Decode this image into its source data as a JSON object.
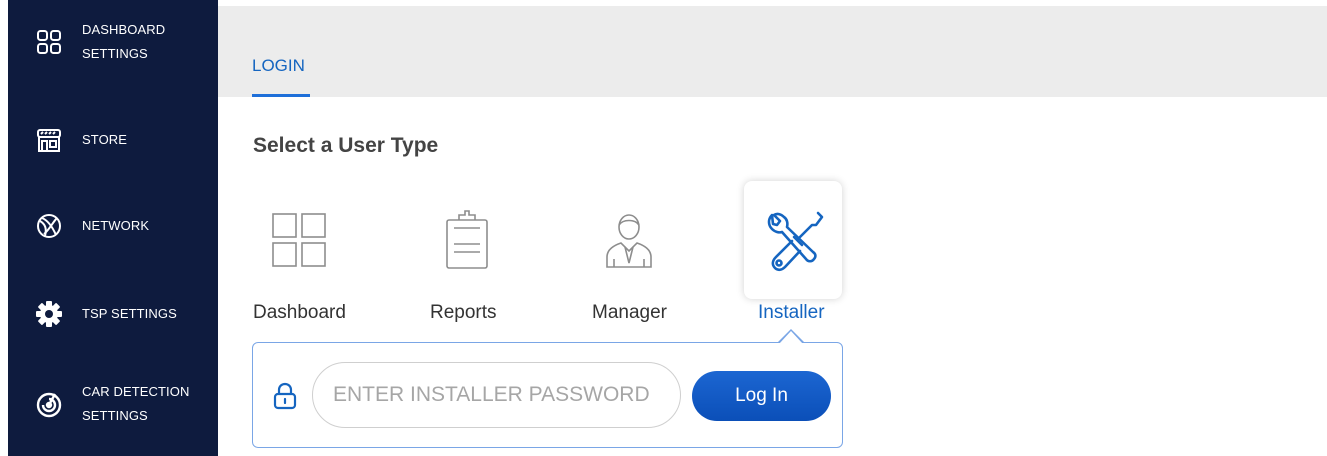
{
  "sidebar": {
    "items": [
      {
        "label": "DASHBOARD\nSETTINGS",
        "icon": "grid-icon"
      },
      {
        "label": "STORE",
        "icon": "store-icon"
      },
      {
        "label": "NETWORK",
        "icon": "globe-icon"
      },
      {
        "label": "TSP SETTINGS",
        "icon": "gear-icon"
      },
      {
        "label": "CAR DETECTION\nSETTINGS",
        "icon": "radar-icon"
      }
    ]
  },
  "header": {
    "tabs": [
      {
        "label": "LOGIN",
        "active": true
      }
    ]
  },
  "main": {
    "section_title": "Select a User Type",
    "user_types": [
      {
        "label": "Dashboard",
        "icon": "grid-icon",
        "selected": false
      },
      {
        "label": "Reports",
        "icon": "clipboard-icon",
        "selected": false
      },
      {
        "label": "Manager",
        "icon": "manager-icon",
        "selected": false
      },
      {
        "label": "Installer",
        "icon": "tools-icon",
        "selected": true
      }
    ],
    "login": {
      "password_placeholder": "ENTER INSTALLER PASSWORD",
      "password_value": "",
      "button_label": "Log In"
    }
  },
  "colors": {
    "sidebar_bg": "#0e1b3e",
    "accent": "#1565c0",
    "topbar_bg": "#ececec"
  }
}
